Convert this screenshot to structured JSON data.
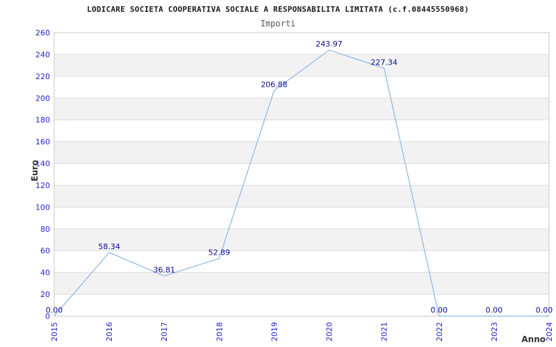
{
  "header": {
    "title": "LODICARE SOCIETA COOPERATIVA SOCIALE A RESPONSABILITA LIMITATA (c.f.08445550968)",
    "subtitle": "Importi"
  },
  "chart_data": {
    "type": "line",
    "title": "Importi",
    "xlabel": "Anno",
    "ylabel": "Euro",
    "categories": [
      "2015",
      "2016",
      "2017",
      "2018",
      "2019",
      "2020",
      "2021",
      "2022",
      "2023",
      "2024"
    ],
    "series": [
      {
        "name": "Importi",
        "values": [
          0,
          58.34,
          36.81,
          52.89,
          206.88,
          243.97,
          227.34,
          0,
          0,
          0
        ]
      }
    ],
    "point_labels": [
      "0.00",
      "58.34",
      "36.81",
      "52.89",
      "206.88",
      "243.97",
      "227.34",
      "0.00",
      "0.00",
      "0.00"
    ],
    "ylim": [
      0,
      260
    ],
    "ytick_step": 20,
    "grid": "horizontal-bands",
    "legend": "none",
    "colors": {
      "line": "#8cb6e6",
      "axis_tick_label": "#2323cb",
      "point_label": "#0b0b8f",
      "band_fill": "#f2f2f2",
      "grid_line": "#dcdcdc",
      "plot_border": "#c9c9c9",
      "axis_title": "#333333",
      "title_text": "#1a1a1a",
      "subtitle_text": "#555555"
    }
  }
}
